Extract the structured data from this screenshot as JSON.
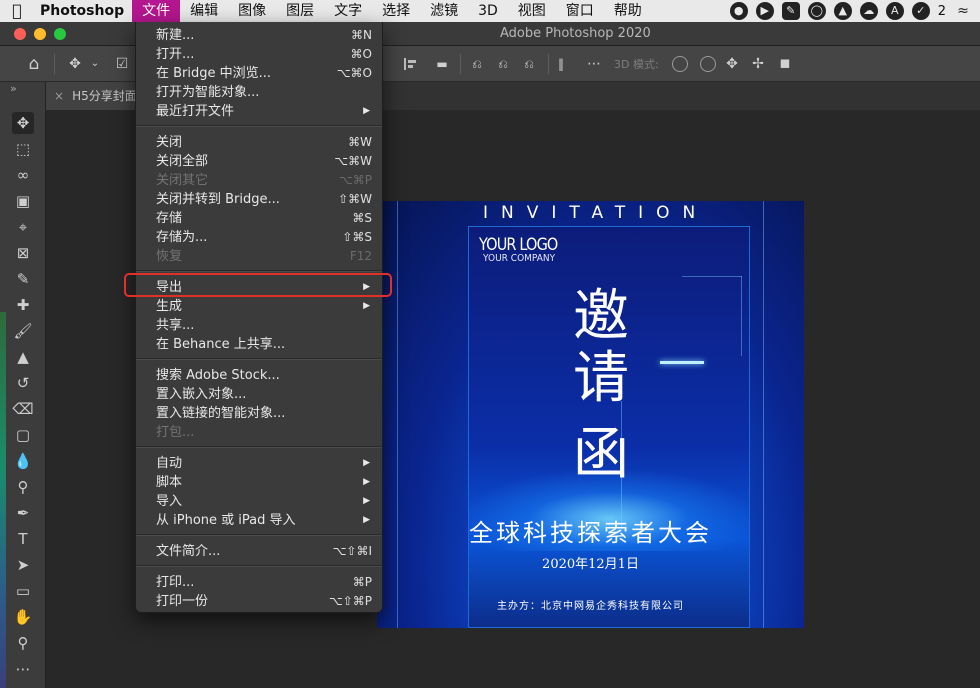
{
  "menubar": {
    "app": "Photoshop",
    "items": [
      "文件",
      "编辑",
      "图像",
      "图层",
      "文字",
      "选择",
      "滤镜",
      "3D",
      "视图",
      "窗口",
      "帮助"
    ],
    "active": "文件",
    "badge_count": "2"
  },
  "window": {
    "title": "Adobe Photoshop 2020"
  },
  "optionsbar": {
    "mode_3d_label": "3D 模式:"
  },
  "document": {
    "tab_label": "H5分享封面"
  },
  "artwork": {
    "invitation": "INVITATION",
    "logo": "YOUR LOGO",
    "company": "YOUR COMPANY",
    "big1": "邀",
    "big2": "请",
    "big3": "函",
    "subtitle": "全球科技探索者大会",
    "date": "2020年12月1日",
    "organizer": "主办方：北京中网易企秀科技有限公司"
  },
  "file_menu": {
    "items": [
      {
        "label": "新建...",
        "shortcut": "⌘N"
      },
      {
        "label": "打开...",
        "shortcut": "⌘O"
      },
      {
        "label": "在 Bridge 中浏览...",
        "shortcut": "⌥⌘O"
      },
      {
        "label": "打开为智能对象..."
      },
      {
        "label": "最近打开文件",
        "submenu": true
      },
      {
        "label": "关闭",
        "shortcut": "⌘W"
      },
      {
        "label": "关闭全部",
        "shortcut": "⌥⌘W"
      },
      {
        "label": "关闭其它",
        "shortcut": "⌥⌘P",
        "disabled": true
      },
      {
        "label": "关闭并转到 Bridge...",
        "shortcut": "⇧⌘W"
      },
      {
        "label": "存储",
        "shortcut": "⌘S"
      },
      {
        "label": "存储为...",
        "shortcut": "⇧⌘S"
      },
      {
        "label": "恢复",
        "shortcut": "F12",
        "disabled": true
      },
      {
        "label": "导出",
        "submenu": true
      },
      {
        "label": "生成",
        "submenu": true
      },
      {
        "label": "共享..."
      },
      {
        "label": "在 Behance 上共享..."
      },
      {
        "label": "搜索 Adobe Stock..."
      },
      {
        "label": "置入嵌入对象..."
      },
      {
        "label": "置入链接的智能对象..."
      },
      {
        "label": "打包...",
        "disabled": true
      },
      {
        "label": "自动",
        "submenu": true
      },
      {
        "label": "脚本",
        "submenu": true
      },
      {
        "label": "导入",
        "submenu": true
      },
      {
        "label": "从 iPhone 或 iPad 导入",
        "submenu": true
      },
      {
        "label": "文件简介...",
        "shortcut": "⌥⇧⌘I"
      },
      {
        "label": "打印...",
        "shortcut": "⌘P"
      },
      {
        "label": "打印一份",
        "shortcut": "⌥⇧⌘P"
      }
    ],
    "highlighted": "导出"
  },
  "colors": {
    "menubar_active": "#b4168f",
    "highlight_box": "#e0302a"
  }
}
